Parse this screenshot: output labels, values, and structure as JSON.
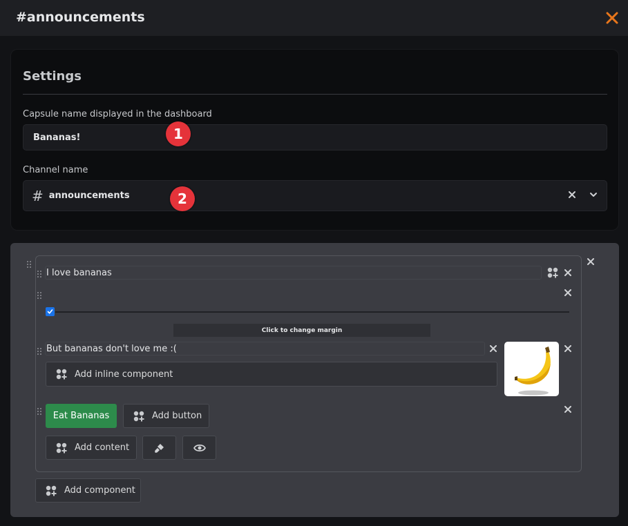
{
  "window": {
    "title": "#announcements"
  },
  "settings": {
    "heading": "Settings",
    "capsule_label": "Capsule name displayed in the dashboard",
    "capsule_value": "Bananas!",
    "channel_label": "Channel name",
    "channel_value": "announcements",
    "channel_hash": "#"
  },
  "markers": [
    "1",
    "2"
  ],
  "builder": {
    "text1": "I love bananas",
    "margin_label": "Click to change margin",
    "text2": "But bananas don't love me :(",
    "add_inline": "Add inline component",
    "eat_button": "Eat Bananas",
    "add_button": "Add button",
    "add_content": "Add content",
    "add_component": "Add component"
  },
  "colors": {
    "accent_close": "#e8761b",
    "marker": "#e5333a",
    "green_button": "#2d8b4b",
    "checkbox": "#1a73e8"
  },
  "icons": [
    "close-icon",
    "hash-icon",
    "clear-icon",
    "chevron-down-icon",
    "grip-icon",
    "component-icon",
    "brush-icon",
    "eye-icon",
    "banana-image"
  ]
}
